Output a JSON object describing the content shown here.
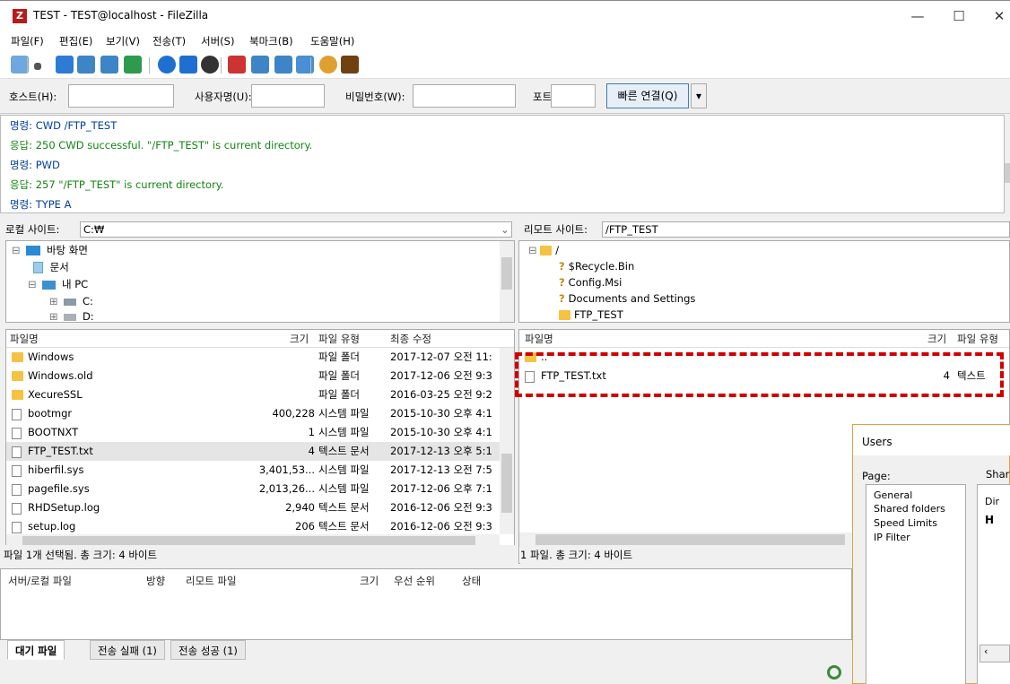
{
  "window": {
    "title": "TEST - TEST@localhost - FileZilla",
    "app_icon_letter": "Z",
    "minimize": "—",
    "maximize": "☐",
    "close": "✕"
  },
  "menu": [
    "파일(F)",
    "편집(E)",
    "보기(V)",
    "전송(T)",
    "서버(S)",
    "북마크(B)",
    "도움말(H)"
  ],
  "toolbar": {
    "icons": [
      "site-manager-icon",
      "dropdown-icon",
      "toggle-log-icon",
      "toggle-local-tree-icon",
      "toggle-remote-tree-icon",
      "toggle-queue-icon",
      "refresh-icon",
      "process-queue-icon",
      "cancel-icon",
      "disconnect-icon",
      "reconnect-icon",
      "filter-icon",
      "compare-icon",
      "sync-browse-icon",
      "search-icon"
    ],
    "colors": [
      "#6fa8dc",
      "#555",
      "#2e7bd6",
      "#3d85c6",
      "#3d85c6",
      "#2e9a4e",
      "#1f6fd1",
      "#1f6fd1",
      "#333333",
      "#cc3333",
      "#3d85c6",
      "#3d85c6",
      "#4a8ed4",
      "#e0a030",
      "#704010"
    ]
  },
  "quickconnect": {
    "host_label": "호스트(H):",
    "user_label": "사용자명(U):",
    "pass_label": "비밀번호(W):",
    "port_label": "포트(P):",
    "host_value": "",
    "user_value": "",
    "pass_value": "",
    "port_value": "",
    "connect_label": "빠른 연결(Q)",
    "dropdown": "▾"
  },
  "log": [
    {
      "type": "cmd",
      "text": "명령: CWD /FTP_TEST"
    },
    {
      "type": "resp",
      "text": "응답: 250 CWD successful. \"/FTP_TEST\" is current directory."
    },
    {
      "type": "cmd",
      "text": "명령: PWD"
    },
    {
      "type": "resp",
      "text": "응답: 257 \"/FTP_TEST\" is current directory."
    },
    {
      "type": "cmd",
      "text": "명령: TYPE A"
    }
  ],
  "local": {
    "site_label": "로컬 사이트:",
    "path": "C:₩",
    "tree": [
      "바탕 화면",
      "문서",
      "내 PC",
      "C:",
      "D:"
    ],
    "headers": {
      "name": "파일명",
      "size": "크기",
      "type": "파일 유형",
      "modified": "최종 수정"
    },
    "files": [
      {
        "name": "Windows",
        "size": "",
        "type": "파일 폴더",
        "modified": "2017-12-07 오전 11:",
        "icon": "folder"
      },
      {
        "name": "Windows.old",
        "size": "",
        "type": "파일 폴더",
        "modified": "2017-12-06 오전 9:3",
        "icon": "folder"
      },
      {
        "name": "XecureSSL",
        "size": "",
        "type": "파일 폴더",
        "modified": "2016-03-25 오전 9:2",
        "icon": "folder"
      },
      {
        "name": "bootmgr",
        "size": "400,228",
        "type": "시스템 파일",
        "modified": "2015-10-30 오후 4:1",
        "icon": "file"
      },
      {
        "name": "BOOTNXT",
        "size": "1",
        "type": "시스템 파일",
        "modified": "2015-10-30 오후 4:1",
        "icon": "file"
      },
      {
        "name": "FTP_TEST.txt",
        "size": "4",
        "type": "텍스트 문서",
        "modified": "2017-12-13 오후 5:1",
        "icon": "file"
      },
      {
        "name": "hiberfil.sys",
        "size": "3,401,53...",
        "type": "시스템 파일",
        "modified": "2017-12-13 오전 7:5",
        "icon": "file"
      },
      {
        "name": "pagefile.sys",
        "size": "2,013,26...",
        "type": "시스템 파일",
        "modified": "2017-12-06 오후 7:1",
        "icon": "file"
      },
      {
        "name": "RHDSetup.log",
        "size": "2,940",
        "type": "텍스트 문서",
        "modified": "2016-12-06 오전 9:3",
        "icon": "file"
      },
      {
        "name": "setup.log",
        "size": "206",
        "type": "텍스트 문서",
        "modified": "2016-12-06 오전 9:3",
        "icon": "file"
      }
    ],
    "status": "파일 1개 선택됨. 총 크기: 4 바이트"
  },
  "remote": {
    "site_label": "리모트 사이트:",
    "path": "/FTP_TEST",
    "tree": [
      "/",
      "$Recycle.Bin",
      "Config.Msi",
      "Documents and Settings",
      "FTP_TEST"
    ],
    "headers": {
      "name": "파일명",
      "size": "크기",
      "type": "파일 유형"
    },
    "files": [
      {
        "name": "..",
        "size": "",
        "type": "",
        "icon": "folder"
      },
      {
        "name": "FTP_TEST.txt",
        "size": "4",
        "type": "텍스트",
        "icon": "file"
      }
    ],
    "status": "1 파일. 총 크기: 4 바이트"
  },
  "queue": {
    "headers": [
      "서버/로컬 파일",
      "방향",
      "리모트 파일",
      "크기",
      "우선 순위",
      "상태"
    ],
    "tabs": [
      "대기 파일",
      "전송 실패 (1)",
      "전송 성공 (1)"
    ]
  },
  "dialog": {
    "title": "Users",
    "page_label": "Page:",
    "partial_label": "Shar",
    "pages": [
      "General",
      "Shared folders",
      "Speed Limits",
      "IP Filter"
    ],
    "dir_partial": "Dir",
    "h_partial": "H"
  }
}
